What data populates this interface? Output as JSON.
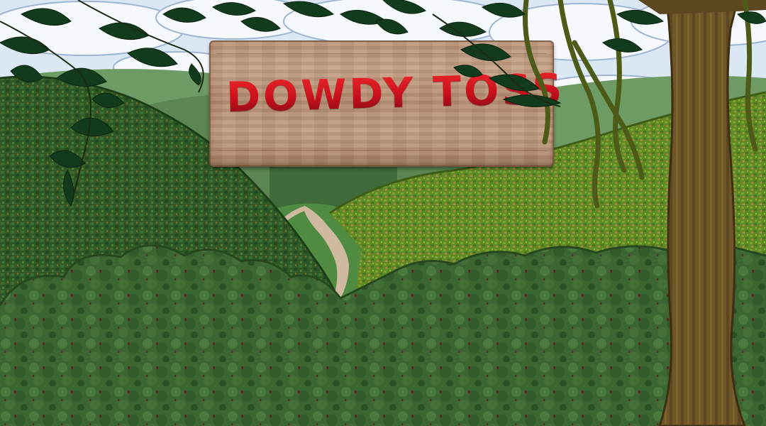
{
  "title": {
    "text": "DOWDY TOSS",
    "color": "#c8101c"
  },
  "colors": {
    "sky": "#d9e6f2",
    "cloud": "#f4f7fb",
    "distant_hill": "#6f9a64",
    "valley_grass": "#4e8a3e",
    "path": "#cdb79c",
    "left_hill": "#2f5a26",
    "right_hill": "#6a8f2a",
    "bush": "#3f6b34",
    "trunk": "#6b5424",
    "vine": "#4f5a18",
    "leaf": "#123a1c",
    "sign_wood": "#b99378"
  }
}
